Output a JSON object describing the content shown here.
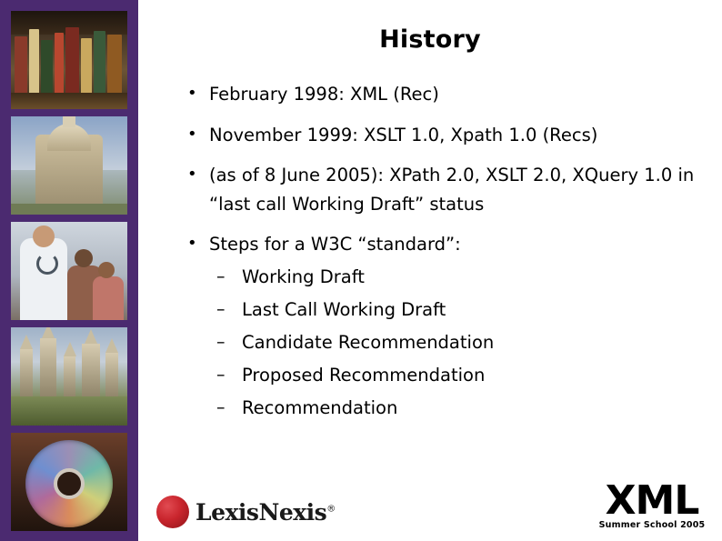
{
  "slide": {
    "title": "History",
    "bullets": [
      {
        "text": "February 1998: XML (Rec)",
        "marker": "•",
        "sub": []
      },
      {
        "text": "November 1999: XSLT 1.0, Xpath 1.0 (Recs)",
        "marker": "•",
        "sub": []
      },
      {
        "text": "(as of 8 June 2005): XPath 2.0, XSLT 2.0, XQuery 1.0 in “last call Working Draft” status",
        "marker": "•",
        "sub": []
      },
      {
        "text": "Steps for a W3C “standard”:",
        "marker": "•",
        "sub": [
          {
            "marker": "–",
            "text": "Working Draft"
          },
          {
            "marker": "–",
            "text": "Last Call Working Draft"
          },
          {
            "marker": "–",
            "text": "Candidate Recommendation"
          },
          {
            "marker": "–",
            "text": "Proposed Recommendation"
          },
          {
            "marker": "–",
            "text": "Recommendation"
          }
        ]
      }
    ]
  },
  "footer": {
    "lexisnexis": {
      "wordmark": "Lexis",
      "wordmark2": "Nexis",
      "registered": "®"
    },
    "xml": {
      "word": "XML",
      "subtitle": "Summer School 2005"
    }
  },
  "sidebar": {
    "photos": [
      {
        "name": "photo-books",
        "caption": "shelf of old books"
      },
      {
        "name": "photo-dome",
        "caption": "Radcliffe Camera dome"
      },
      {
        "name": "photo-doctor",
        "caption": "doctor with patients"
      },
      {
        "name": "photo-spires",
        "caption": "Oxford spires"
      },
      {
        "name": "photo-cd",
        "caption": "compact disc"
      }
    ]
  },
  "colors": {
    "sidebar_purple": "#4b2a70",
    "text_black": "#000000",
    "background": "#ffffff",
    "lexisnexis_red": "#c9252d"
  }
}
